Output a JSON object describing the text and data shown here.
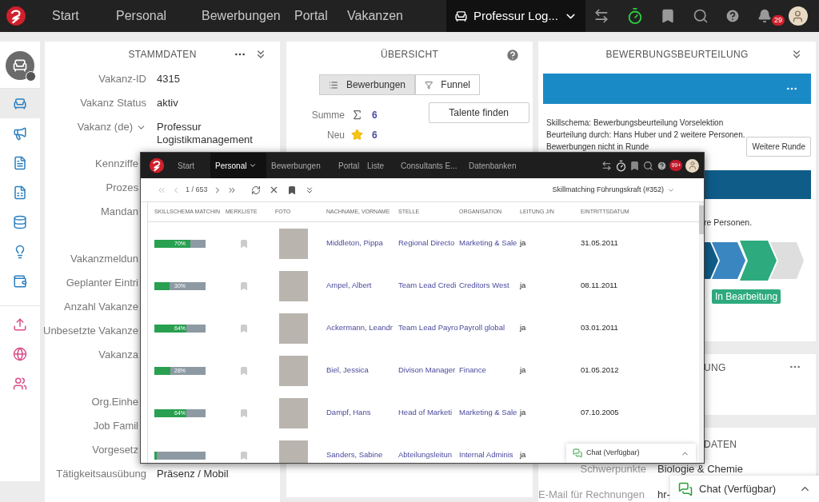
{
  "topbar": {
    "nav": [
      "Start",
      "Personal",
      "Bewerbungen",
      "Portal",
      "Vakanzen"
    ],
    "context": "Professur Log...",
    "notification_count": "29"
  },
  "sidebar": {
    "groups": [
      [
        {
          "selected": true
        },
        {
          "selected": false
        },
        {
          "selected": false
        },
        {
          "selected": false
        },
        {
          "selected": false
        },
        {
          "selected": false
        },
        {
          "selected": false
        }
      ],
      [
        {
          "selected": false
        },
        {
          "selected": false
        },
        {
          "selected": false
        }
      ]
    ]
  },
  "stammdaten": {
    "title": "STAMMDATEN",
    "groups": [
      [
        {
          "label": "Vakanz-ID",
          "value": "4315",
          "kind": "text"
        },
        {
          "label": "Vakanz Status",
          "value": "aktiv",
          "kind": "text"
        },
        {
          "label": "Vakanz (de)",
          "value": "Professur Logistikmanagement",
          "kind": "select"
        },
        {
          "label": "Kennziffe",
          "kind": "text"
        },
        {
          "label": "Prozes",
          "kind": "text"
        },
        {
          "label": "Mandan",
          "kind": "text"
        }
      ],
      [
        {
          "label": "Vakanzmeldun",
          "kind": "text"
        },
        {
          "label": "Geplanter Eintri",
          "kind": "text"
        },
        {
          "label": "Anzahl Vakanze",
          "kind": "text"
        },
        {
          "label": "Unbesetzte Vakanze",
          "kind": "text"
        },
        {
          "label": "Vakanza",
          "kind": "text"
        }
      ],
      [
        {
          "label": "Org.Einhe",
          "kind": "text"
        },
        {
          "label": "Job Famil",
          "kind": "text"
        },
        {
          "label": "Vorgesetz",
          "kind": "text"
        },
        {
          "label": "Tätigkeitsausübung",
          "value": "Präsenz / Mobil",
          "kind": "text"
        }
      ]
    ]
  },
  "uebersicht": {
    "title": "ÜBERSICHT",
    "views": [
      {
        "label": "Bewerbungen",
        "kind": "list",
        "selected": true
      },
      {
        "label": "Funnel",
        "kind": "funnel",
        "selected": false
      }
    ],
    "stats": [
      {
        "label": "Summe",
        "kind": "sum",
        "value": "6"
      },
      {
        "label": "Neu",
        "kind": "new",
        "value": "6"
      }
    ],
    "action": "Talente finden"
  },
  "beurteilung": {
    "title": "BEWERBUNGSBEURTEILUNG",
    "lines": [
      "Skillschema: Bewerbungsbeurteilung Vorselektion",
      "Beurteilung durch: Hans Huber und 2 weitere Personen.",
      "Bewerbungen nicht in Runde"
    ],
    "action": "Weitere Runde",
    "partial_text": "re Personen.",
    "status": "In Bearbeitung"
  },
  "card_4": {
    "title": "UNG"
  },
  "card_5": {
    "title": "DATEN",
    "fields": [
      {
        "label": "Schwerpunkte",
        "value": "Biologie & Chemie",
        "kind": "text"
      },
      {
        "label": "E-Mail für Rechnungen",
        "value": "hr-",
        "kind": "select"
      }
    ]
  },
  "chat": {
    "label": "Chat (Verfügbar)"
  },
  "overlay": {
    "nav": [
      {
        "label": "Start",
        "selected": false
      },
      {
        "label": "Personal",
        "selected": true
      },
      {
        "label": "Bewerbungen",
        "selected": false
      },
      {
        "label": "Portal",
        "selected": false
      },
      {
        "label": "Liste",
        "selected": false
      },
      {
        "label": "Consultants E...",
        "selected": false
      },
      {
        "label": "Datenbanken",
        "selected": false
      }
    ],
    "notification_count": "99+",
    "pager": "1 / 653",
    "view": "Skillmatching Führungskraft (#352)",
    "table": {
      "columns": [
        "SKILLSCHEMA MATCHIN",
        "MERKLISTE",
        "FOTO",
        "NACHNAME, VORNAME",
        "STELLE",
        "ORGANISATION",
        "LEITUNG J/N",
        "EINTRITTSDATUM"
      ],
      "rows": [
        {
          "level": 0.7,
          "reading": "70%",
          "name": "Middleton, Pippa",
          "position": "Regional Directo",
          "organisation": "Marketing & Sale",
          "lead": "ja",
          "start_date": "31.05.2011"
        },
        {
          "level": 0.3,
          "reading": "30%",
          "name": "Ampel, Albert",
          "position": "Team Lead Credi",
          "organisation": "Creditors West",
          "lead": "ja",
          "start_date": "08.11.2011"
        },
        {
          "level": 0.63,
          "reading": "64%",
          "name": "Ackermann, Leandr",
          "position": "Team Lead Payro",
          "organisation": "Payroll global",
          "lead": "ja",
          "start_date": "03.01.2011"
        },
        {
          "level": 0.31,
          "reading": "28%",
          "name": "Biel, Jessica",
          "position": "Divison Manager",
          "organisation": "Finance",
          "lead": "ja",
          "start_date": "01.05.2012"
        },
        {
          "level": 0.63,
          "reading": "64%",
          "name": "Dampf, Hans",
          "position": "Head of Marketi",
          "organisation": "Marketing & Sale",
          "lead": "ja",
          "start_date": "07.10.2005"
        },
        {
          "level": 0.05,
          "name": "Sanders, Sabine",
          "position": "Abteilungsleitun",
          "organisation": "Internal Adminis",
          "lead": "ja"
        }
      ]
    },
    "chat": {
      "label": "Chat (Verfügbar)"
    }
  }
}
